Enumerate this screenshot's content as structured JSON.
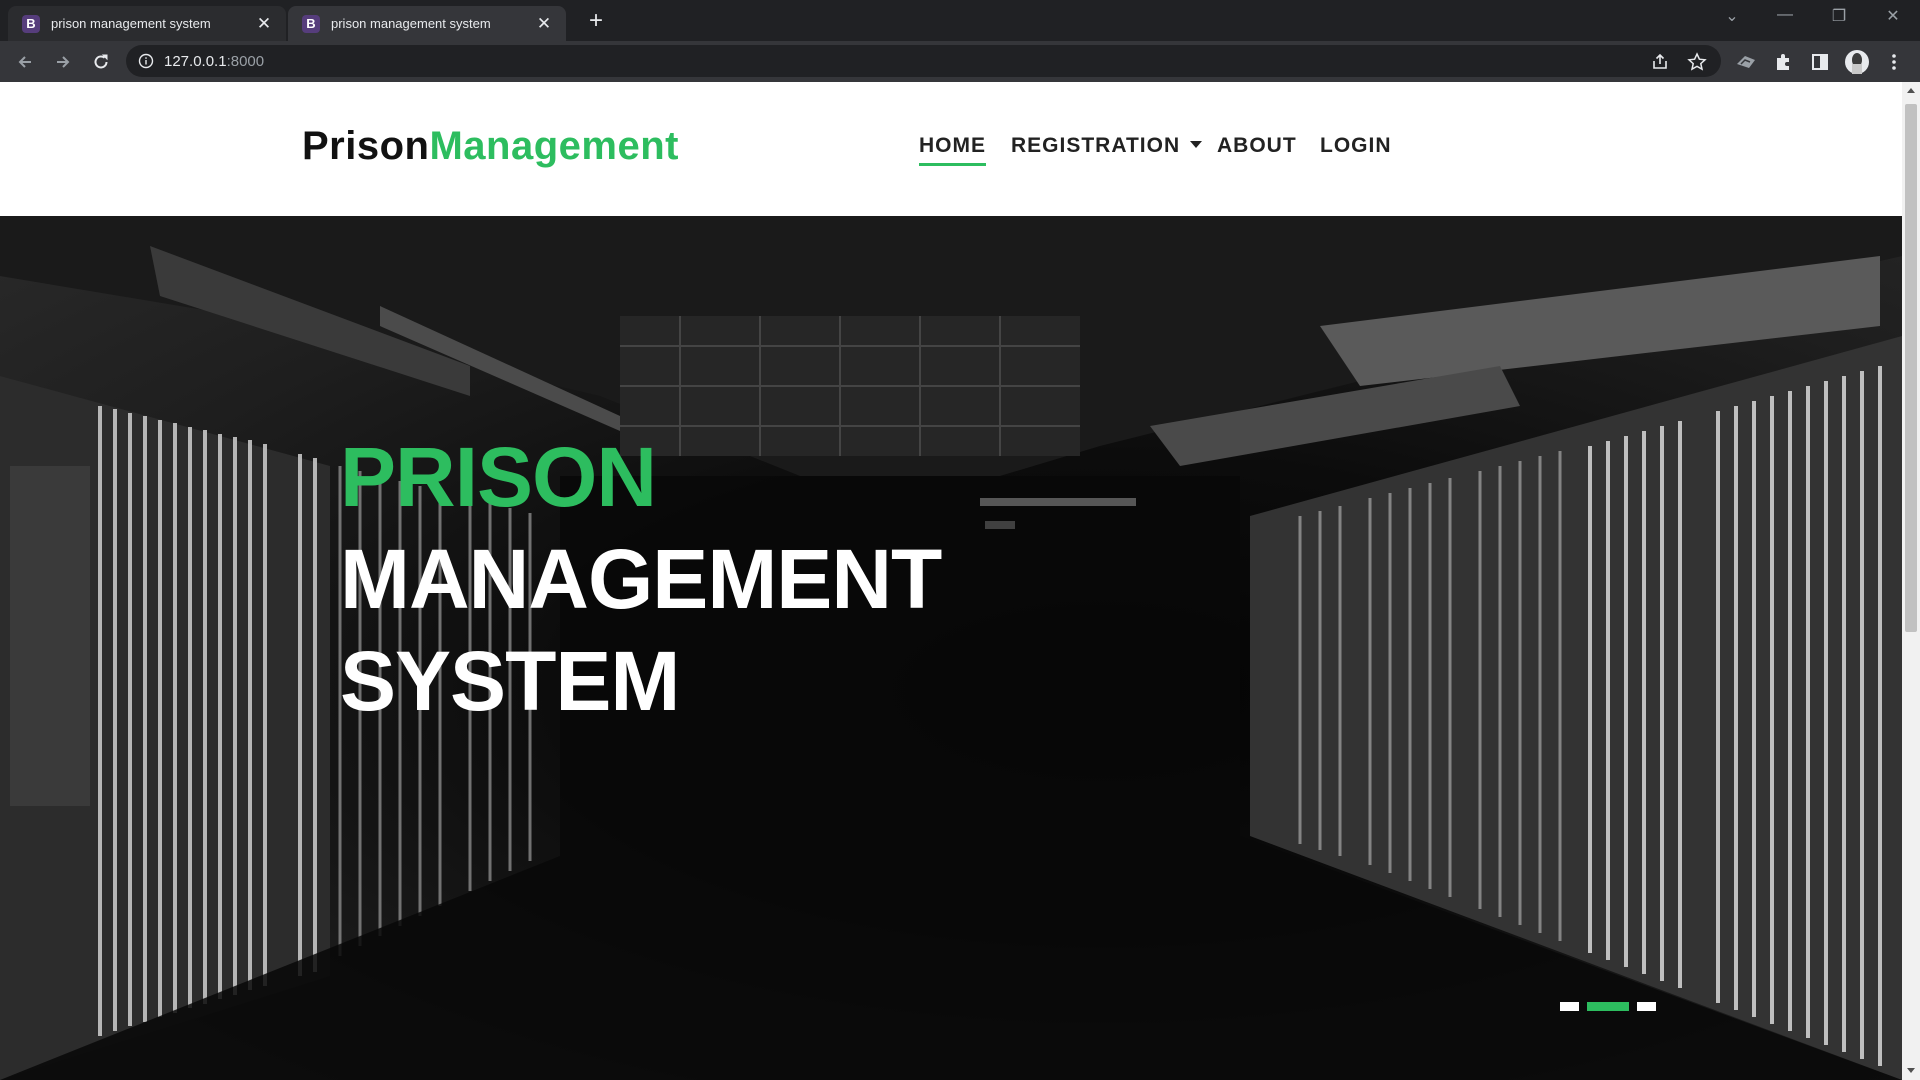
{
  "browser": {
    "tabs": [
      {
        "favicon": "B",
        "title": "prison management system",
        "active": false
      },
      {
        "favicon": "B",
        "title": "prison management system",
        "active": true
      }
    ],
    "address": {
      "host": "127.0.0.1",
      "port": ":8000"
    },
    "icons": [
      "back-icon",
      "forward-icon",
      "reload-icon",
      "info-icon",
      "share-icon",
      "star-icon",
      "extension-icon",
      "puzzle-icon",
      "side-panel-icon",
      "avatar",
      "more-icon"
    ]
  },
  "site": {
    "logo": {
      "part1": "Prison",
      "part2": "Management"
    },
    "nav": [
      {
        "label": "HOME",
        "active": true
      },
      {
        "label": "REGISTRATION",
        "dropdown": true
      },
      {
        "label": "ABOUT"
      },
      {
        "label": "LOGIN"
      }
    ]
  },
  "hero": {
    "title_line1": "PRISON",
    "title_line2": "MANAGEMENT",
    "title_line3": "SYSTEM",
    "slides": 3,
    "active_slide": 2
  },
  "colors": {
    "accent": "#2dbd5f",
    "favicon": "#563d7c"
  }
}
